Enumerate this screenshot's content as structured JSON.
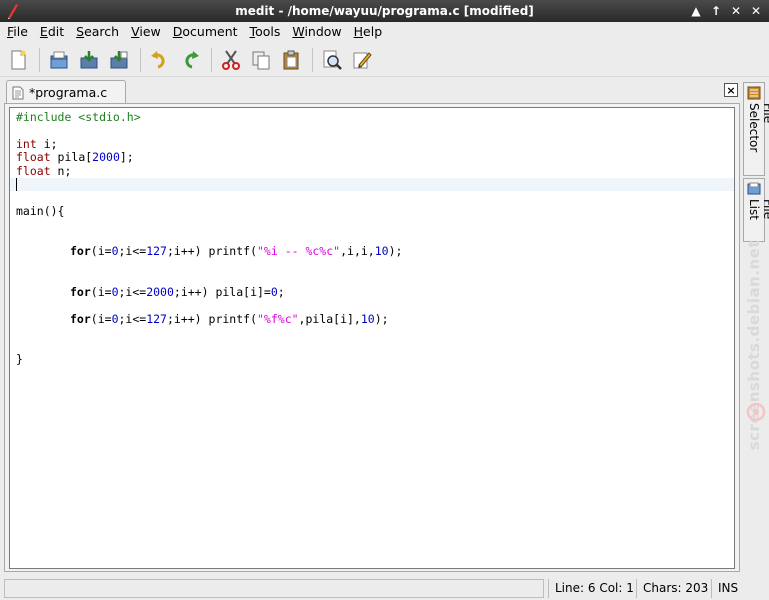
{
  "window": {
    "title": "medit - /home/wayuu/programa.c [modified]",
    "controls": [
      "▲",
      "↑",
      "✕",
      "✕"
    ]
  },
  "menu": {
    "items": [
      {
        "label_u": "F",
        "label_rest": "ile"
      },
      {
        "label_u": "E",
        "label_rest": "dit"
      },
      {
        "label_u": "S",
        "label_rest": "earch"
      },
      {
        "label_u": "V",
        "label_rest": "iew"
      },
      {
        "label_u": "D",
        "label_rest": "ocument"
      },
      {
        "label_u": "T",
        "label_rest": "ools"
      },
      {
        "label_u": "W",
        "label_rest": "indow"
      },
      {
        "label_u": "H",
        "label_rest": "elp"
      }
    ]
  },
  "toolbar": {
    "icons": [
      "new-document-icon",
      "open-folder-icon",
      "save-icon",
      "save-as-icon",
      "undo-icon",
      "redo-icon",
      "cut-icon",
      "copy-icon",
      "paste-icon",
      "find-icon",
      "edit-icon"
    ]
  },
  "tab": {
    "label": "*programa.c",
    "close": "×"
  },
  "side_panel": {
    "file_selector": "File Selector",
    "file_list": "File List"
  },
  "watermark": "screenshots.debian.net",
  "code": {
    "l1": "#include <stdio.h>",
    "l3_kw": "int",
    "l3_rest": " i;",
    "l4_kw": "float",
    "l4_a": " pila[",
    "l4_num": "2000",
    "l4_b": "];",
    "l5_kw": "float",
    "l5_rest": " n;",
    "l8": "main(){",
    "l11_kw": "for",
    "l11_a": "(i=",
    "l11_n1": "0",
    "l11_b": ";i<=",
    "l11_n2": "127",
    "l11_c": ";i++) printf(",
    "l11_s": "\"%i -- %c%c\"",
    "l11_d": ",i,i,",
    "l11_n3": "10",
    "l11_e": ");",
    "l14_kw": "for",
    "l14_a": "(i=",
    "l14_n1": "0",
    "l14_b": ";i<=",
    "l14_n2": "2000",
    "l14_c": ";i++) pila[i]=",
    "l14_n3": "0",
    "l14_d": ";",
    "l16_kw": "for",
    "l16_a": "(i=",
    "l16_n1": "0",
    "l16_b": ";i<=",
    "l16_n2": "127",
    "l16_c": ";i++) printf(",
    "l16_s": "\"%f%c\"",
    "l16_d": ",pila[i],",
    "l16_n3": "10",
    "l16_e": ");",
    "l19": "}"
  },
  "status": {
    "position": "Line: 6 Col: 1",
    "chars": "Chars: 203",
    "mode": "INS"
  },
  "colors": {
    "preprocessor": "#1e7f1e",
    "type_keyword": "#8b0000",
    "number": "#0000cc",
    "string": "#e000e0",
    "current_line": "#eef6fb"
  }
}
